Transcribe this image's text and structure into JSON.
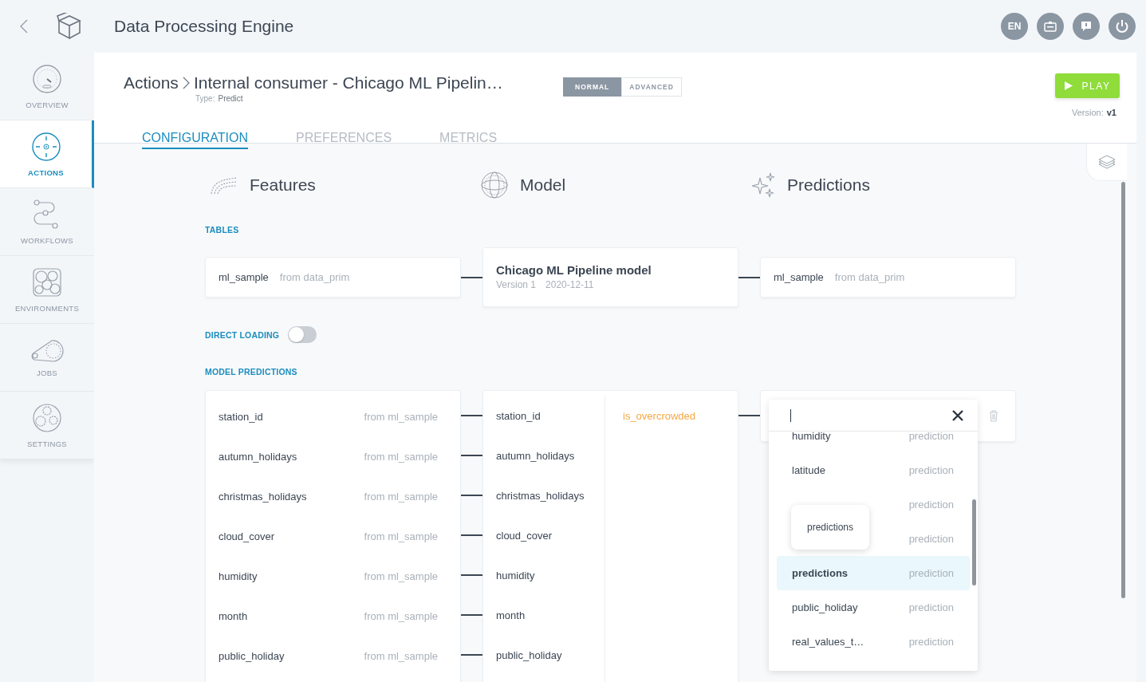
{
  "top_bar": {
    "title": "Data Processing Engine",
    "language_button": "EN"
  },
  "sidebar": {
    "items": [
      {
        "label": "OVERVIEW",
        "selected": false
      },
      {
        "label": "ACTIONS",
        "selected": true
      },
      {
        "label": "WORKFLOWS",
        "selected": false
      },
      {
        "label": "ENVIRONMENTS",
        "selected": false
      },
      {
        "label": "JOBS",
        "selected": false
      },
      {
        "label": "SETTINGS",
        "selected": false
      }
    ]
  },
  "page": {
    "breadcrumb": "Actions",
    "title": "Internal consumer - Chicago ML Pipelin…",
    "type_label": "Type:",
    "type_value": "Predict",
    "modes": [
      {
        "label": "NORMAL",
        "selected": true
      },
      {
        "label": "ADVANCED",
        "selected": false
      }
    ],
    "play_button": "PLAY",
    "version_label": "Version:",
    "version_value": "v1",
    "tabs": [
      {
        "label": "CONFIGURATION",
        "selected": true
      },
      {
        "label": "PREFERENCES",
        "selected": false
      },
      {
        "label": "METRICS",
        "selected": false
      }
    ]
  },
  "sections": [
    "Features",
    "Model",
    "Predictions"
  ],
  "tables": {
    "title": "TABLES",
    "input": {
      "name": "ml_sample",
      "source": "from data_prim"
    },
    "model": {
      "name": "Chicago ML Pipeline model",
      "version": "Version 1",
      "date": "2020-12-11"
    },
    "output": {
      "name": "ml_sample",
      "source": "from data_prim"
    }
  },
  "direct_loading": {
    "label": "DIRECT LOADING",
    "on": false
  },
  "model_predictions": {
    "title": "MODEL PREDICTIONS",
    "features": [
      {
        "name": "station_id",
        "source": "from ml_sample"
      },
      {
        "name": "autumn_holidays",
        "source": "from ml_sample"
      },
      {
        "name": "christmas_holidays",
        "source": "from ml_sample"
      },
      {
        "name": "cloud_cover",
        "source": "from ml_sample"
      },
      {
        "name": "humidity",
        "source": "from ml_sample"
      },
      {
        "name": "month",
        "source": "from ml_sample"
      },
      {
        "name": "public_holiday",
        "source": "from ml_sample"
      }
    ],
    "model_inputs": [
      "station_id",
      "autumn_holidays",
      "christmas_holidays",
      "cloud_cover",
      "humidity",
      "month",
      "public_holiday"
    ],
    "model_outputs": [
      "is_overcrowded"
    ],
    "dropdown": {
      "tooltip": "predictions",
      "items": [
        {
          "name": "humidity",
          "type": "prediction",
          "selected": false
        },
        {
          "name": "latitude",
          "type": "prediction",
          "selected": false
        },
        {
          "type": "prediction",
          "selected": false
        },
        {
          "type": "prediction",
          "selected": false
        },
        {
          "name": "predictions",
          "type": "prediction",
          "selected": true
        },
        {
          "name": "public_holiday",
          "type": "prediction",
          "selected": false
        },
        {
          "name": "real_values_t…",
          "type": "prediction",
          "selected": false
        }
      ]
    }
  }
}
